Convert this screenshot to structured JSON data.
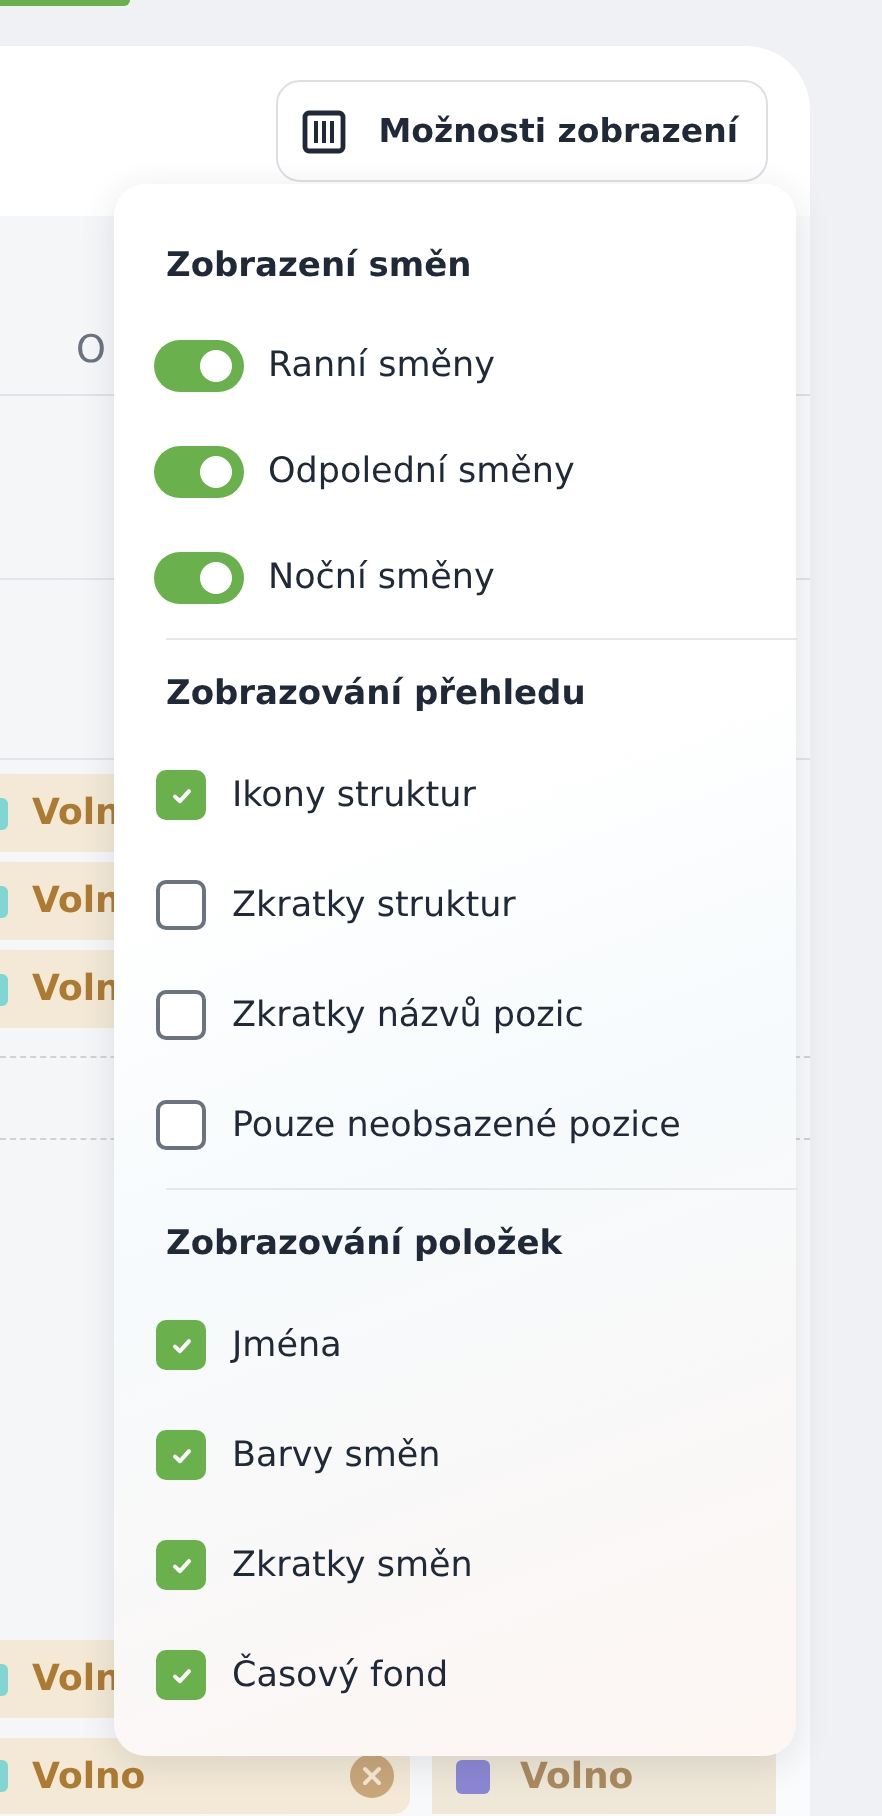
{
  "toolbar": {
    "button": {
      "label": "Možnosti zobrazení"
    }
  },
  "table": {
    "header": "O",
    "chip_groups": [
      {
        "chips": [
          {
            "label": "Voln",
            "color": "#7fd6d2"
          },
          {
            "label": "Voln",
            "color": "#7fd6d2"
          },
          {
            "label": "Voln",
            "color": "#7fd6d2"
          }
        ]
      },
      {
        "chips": [
          {
            "label": "Voln",
            "color": "#7fd6d2"
          }
        ]
      },
      {
        "chips": [
          {
            "label": "Volno",
            "color": "#7fd6d2",
            "removable": true
          },
          {
            "label": "Volno",
            "color": "#8b87d4",
            "removable": false
          }
        ]
      }
    ]
  },
  "popup": {
    "sections": [
      {
        "title": "Zobrazení směn",
        "items": [
          {
            "kind": "toggle",
            "label": "Ranní směny",
            "checked": true
          },
          {
            "kind": "toggle",
            "label": "Odpolední směny",
            "checked": true
          },
          {
            "kind": "toggle",
            "label": "Noční směny",
            "checked": true
          }
        ]
      },
      {
        "title": "Zobrazování přehledu",
        "items": [
          {
            "kind": "checkbox",
            "label": "Ikony struktur",
            "checked": true
          },
          {
            "kind": "checkbox",
            "label": "Zkratky struktur",
            "checked": false
          },
          {
            "kind": "checkbox",
            "label": "Zkratky názvů pozic",
            "checked": false
          },
          {
            "kind": "checkbox",
            "label": "Pouze neobsazené pozice",
            "checked": false
          }
        ]
      },
      {
        "title": "Zobrazování položek",
        "items": [
          {
            "kind": "checkbox",
            "label": "Jména",
            "checked": true
          },
          {
            "kind": "checkbox",
            "label": "Barvy směn",
            "checked": true
          },
          {
            "kind": "checkbox",
            "label": "Zkratky směn",
            "checked": true
          },
          {
            "kind": "checkbox",
            "label": "Časový fond",
            "checked": true
          }
        ]
      }
    ]
  }
}
